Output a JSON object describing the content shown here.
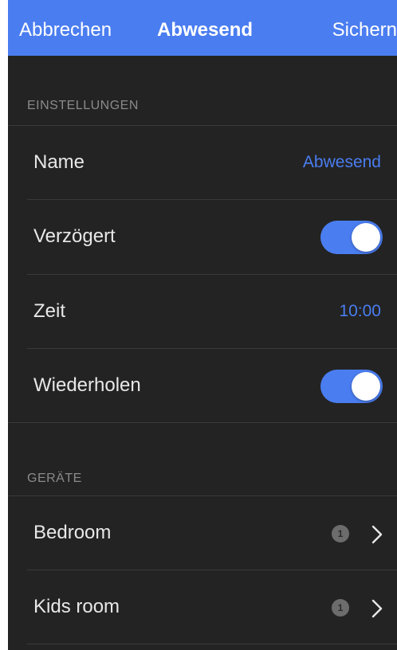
{
  "navbar": {
    "cancel_label": "Abbrechen",
    "title": "Abwesend",
    "save_label": "Sichern"
  },
  "settings": {
    "header": "EINSTELLUNGEN",
    "rows": [
      {
        "label": "Name",
        "value": "Abwesend"
      },
      {
        "label": "Verzögert",
        "toggle_on": true
      },
      {
        "label": "Zeit",
        "value": "10:00"
      },
      {
        "label": "Wiederholen",
        "toggle_on": true
      }
    ]
  },
  "devices": {
    "header": "GERÄTE",
    "rows": [
      {
        "label": "Bedroom",
        "badge": "1",
        "icon": "chevron-right-icon"
      },
      {
        "label": "Kids room",
        "badge": "1",
        "icon": "chevron-right-icon"
      }
    ]
  },
  "colors": {
    "accent": "#4a7df0",
    "background": "#232323",
    "text": "#e8e8e8",
    "section_header": "#8a8a8a"
  }
}
